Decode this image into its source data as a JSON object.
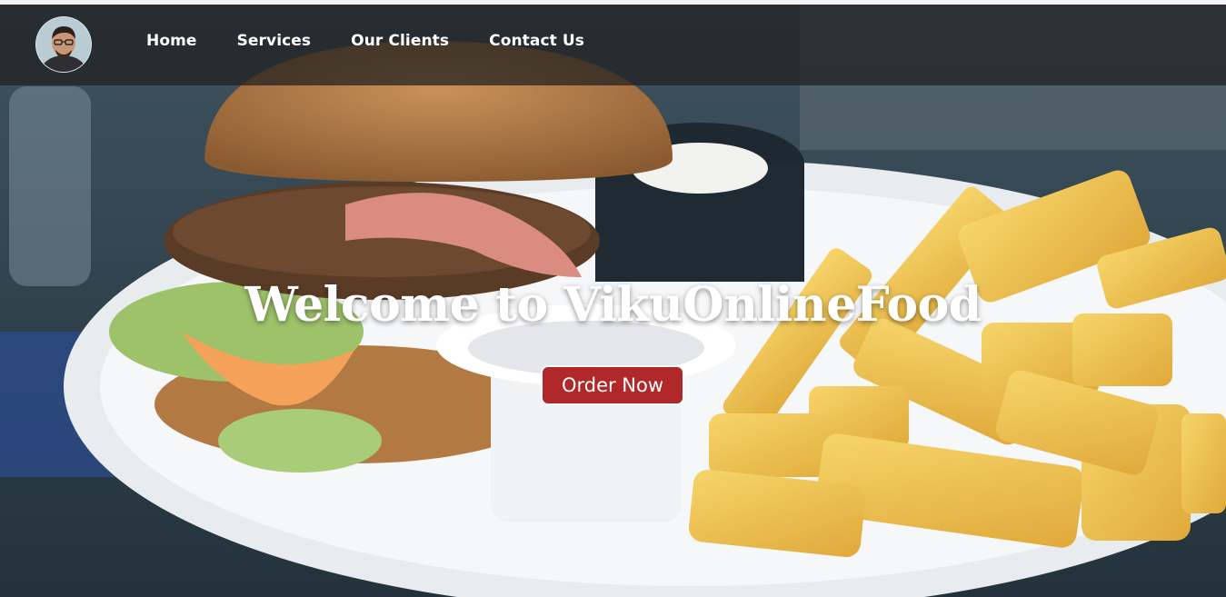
{
  "nav": {
    "items": [
      {
        "label": "Home"
      },
      {
        "label": "Services"
      },
      {
        "label": "Our Clients"
      },
      {
        "label": "Contact Us"
      }
    ]
  },
  "hero": {
    "title": "Welcome to VikuOnlineFood",
    "cta_label": "Order Now"
  },
  "colors": {
    "navbar_bg": "#1e1e1e",
    "cta_bg": "#b0282a",
    "text": "#ffffff"
  },
  "icons": {
    "avatar": "profile-photo"
  }
}
